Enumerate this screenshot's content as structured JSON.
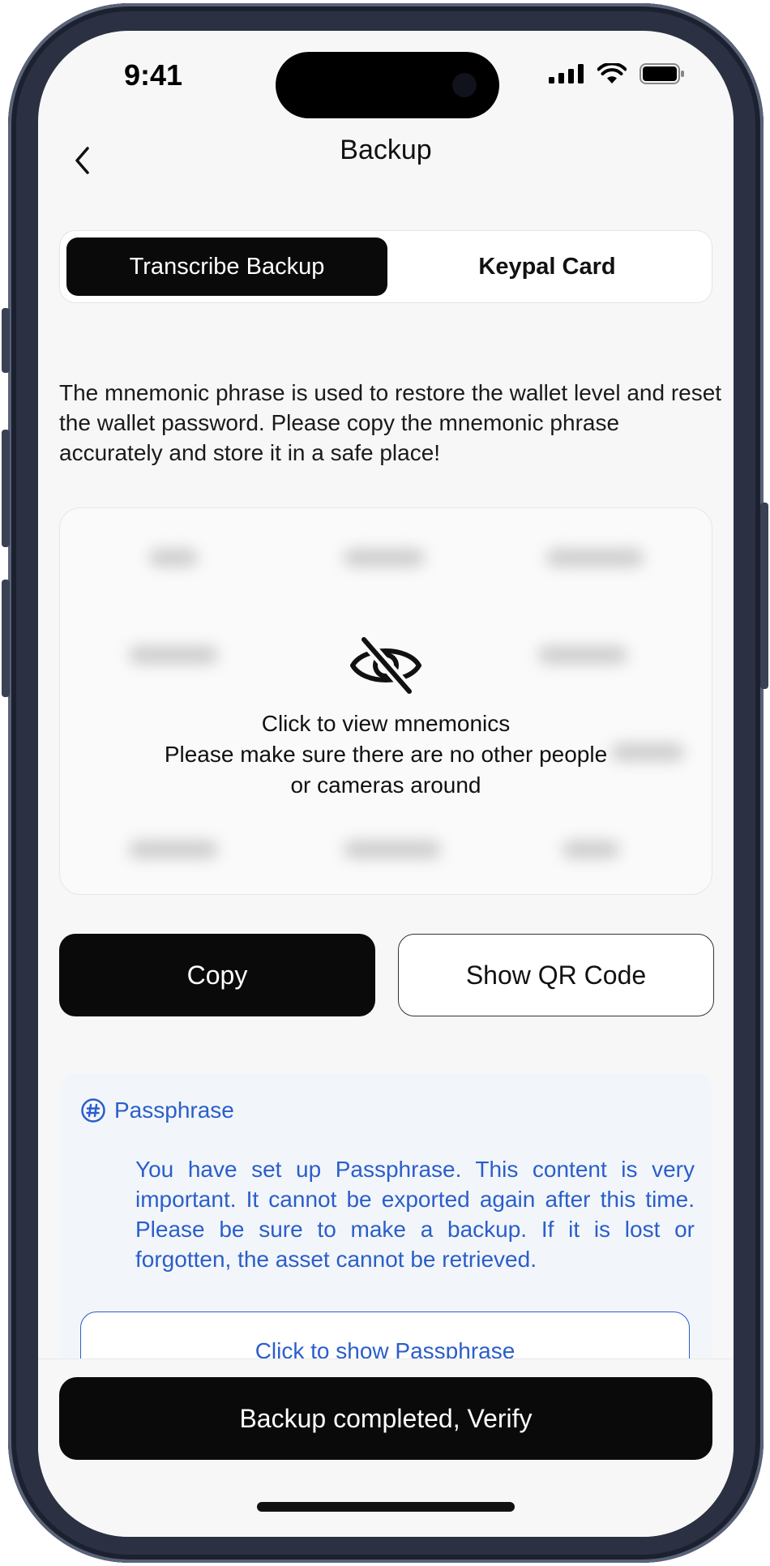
{
  "status_bar": {
    "time": "9:41"
  },
  "nav": {
    "title": "Backup"
  },
  "tabs": [
    {
      "label": "Transcribe Backup",
      "active": true
    },
    {
      "label": "Keypal Card",
      "active": false
    }
  ],
  "description": "The mnemonic phrase is used to restore the wallet level and reset the wallet password. Please copy the mnemonic phrase accurately and store it in a safe place!",
  "mnemonic": {
    "line1": "Click to view mnemonics",
    "line2": "Please make sure there are no other people",
    "line3": "or cameras around"
  },
  "actions": {
    "copy_label": "Copy",
    "qr_label": "Show QR Code"
  },
  "passphrase": {
    "title": "Passphrase",
    "text": "You have set up Passphrase. This content is very important. It cannot be exported again after this time. Please be sure to make a backup. If it is lost or forgotten, the asset cannot be retrieved.",
    "button_label": "Click to show Passphrase"
  },
  "footer": {
    "verify_label": "Backup completed, Verify"
  },
  "colors": {
    "primary": "#0a0a0a",
    "accent_blue": "#2b5ec9",
    "background": "#f7f7f7"
  }
}
